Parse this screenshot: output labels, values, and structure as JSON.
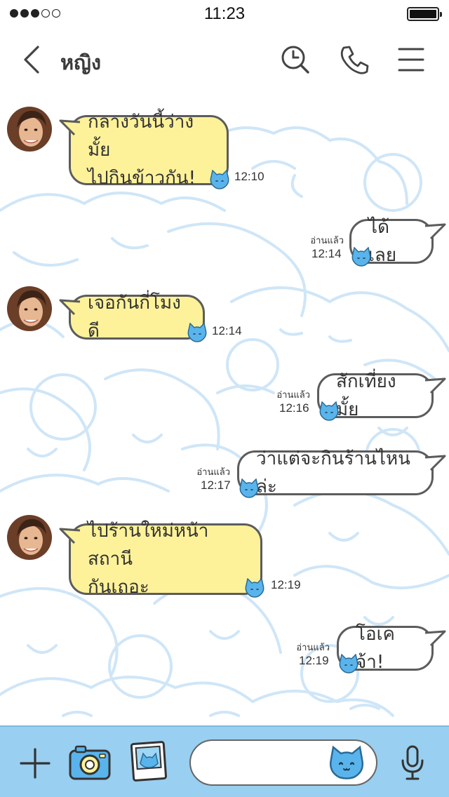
{
  "status_bar": {
    "signal_filled": 3,
    "signal_total": 5,
    "time": "11:23",
    "battery_level": 1.0
  },
  "header": {
    "back_icon": "chevron-left-icon",
    "title": "หญิง",
    "icons": [
      "search-history-icon",
      "phone-icon",
      "menu-icon"
    ]
  },
  "messages": [
    {
      "side": "left",
      "text": "กลางวันนี้ว่างมั้ย\nไปกินข้าวกัน!",
      "time": "12:10"
    },
    {
      "side": "right",
      "text": "ได้เลย",
      "time": "12:14",
      "read": "อ่านแล้ว"
    },
    {
      "side": "left",
      "text": "เจอกันกี่โมงดี",
      "time": "12:14"
    },
    {
      "side": "right",
      "text": "สักเที่ยงมั้ย",
      "time": "12:16",
      "read": "อ่านแล้ว"
    },
    {
      "side": "right",
      "text": "ว่าแต่จะกินร้านไหนล่ะ",
      "time": "12:17",
      "read": "อ่านแล้ว"
    },
    {
      "side": "left",
      "text": "ไปร้านใหม่หน้าสถานี\nกันเถอะ",
      "time": "12:19"
    },
    {
      "side": "right",
      "text": "โอเคจ้า!",
      "time": "12:19",
      "read": "อ่านแล้ว"
    }
  ],
  "bottom_bar": {
    "icons": [
      "plus-icon",
      "camera-icon",
      "photo-icon",
      "sticker-cat-icon",
      "microphone-icon"
    ],
    "input_value": "",
    "input_placeholder": ""
  },
  "colors": {
    "bubble_left": "#fdf29a",
    "bubble_right": "#ffffff",
    "bubble_border": "#5c5c5c",
    "bottom_bar": "#99cff0",
    "doodle": "#cfe6f7",
    "cat_accent": "#5ab4ec"
  }
}
